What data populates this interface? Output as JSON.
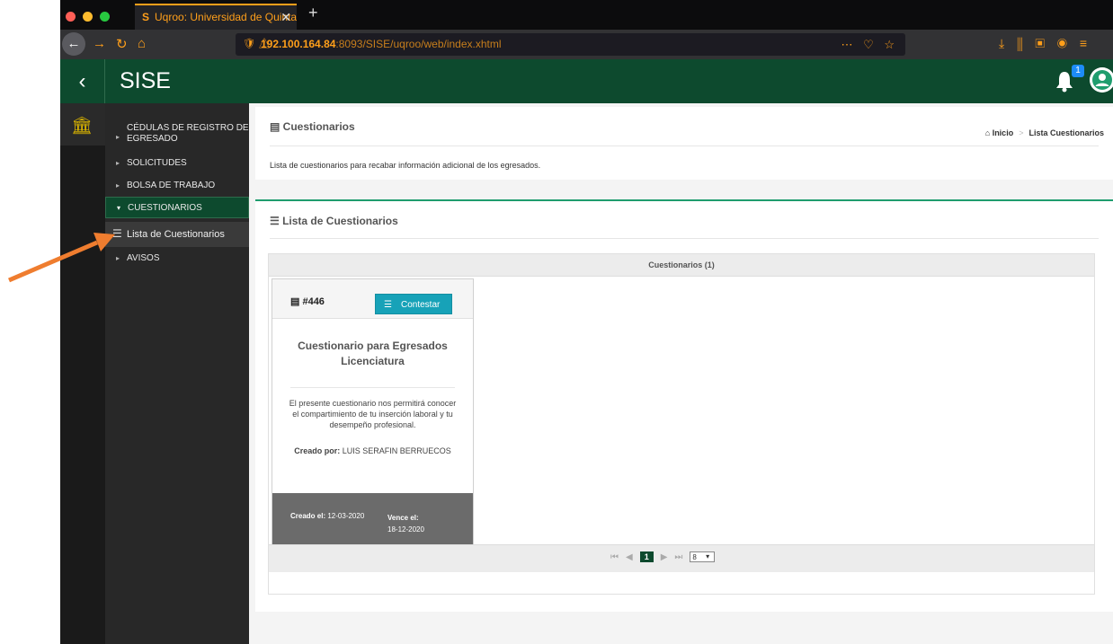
{
  "browser": {
    "tab_title": "Uqroo: Universidad de Quintan",
    "url_host": "192.100.164.84",
    "url_rest": ":8093/SISE/uqroo/web/index.xhtml",
    "accent": "#ff9f1a"
  },
  "header": {
    "title": "SISE",
    "notification_count": "1",
    "brand_color": "#0d4a2e"
  },
  "sidebar": {
    "items": [
      {
        "label": "CÉDULAS DE REGISTRO DE EGRESADO"
      },
      {
        "label": "SOLICITUDES"
      },
      {
        "label": "BOLSA DE TRABAJO"
      },
      {
        "label": "CUESTIONARIOS"
      },
      {
        "label": "Lista de Cuestionarios"
      },
      {
        "label": "AVISOS"
      }
    ]
  },
  "page": {
    "title": "Cuestionarios",
    "breadcrumb": {
      "home": "Inicio",
      "current": "Lista Cuestionarios"
    },
    "description": "Lista de cuestionarios para recabar información adicional de los egresados.",
    "list_title": "Lista de Cuestionarios"
  },
  "grid": {
    "header": "Cuestionarios (1)",
    "card": {
      "id": "#446",
      "button": "Contestar",
      "title": "Cuestionario para Egresados Licenciatura",
      "description": "El presente cuestionario nos permitirá conocer el compartimiento de tu inserción laboral y tu desempeño profesional.",
      "author_label": "Creado por:",
      "author": "LUIS SERAFIN BERRUECOS",
      "created_label": "Creado el:",
      "created": "12-03-2020",
      "due_label": "Vence el:",
      "due": "18-12-2020"
    },
    "paginator": {
      "current_page": "1",
      "rows_per_page": "8"
    }
  }
}
